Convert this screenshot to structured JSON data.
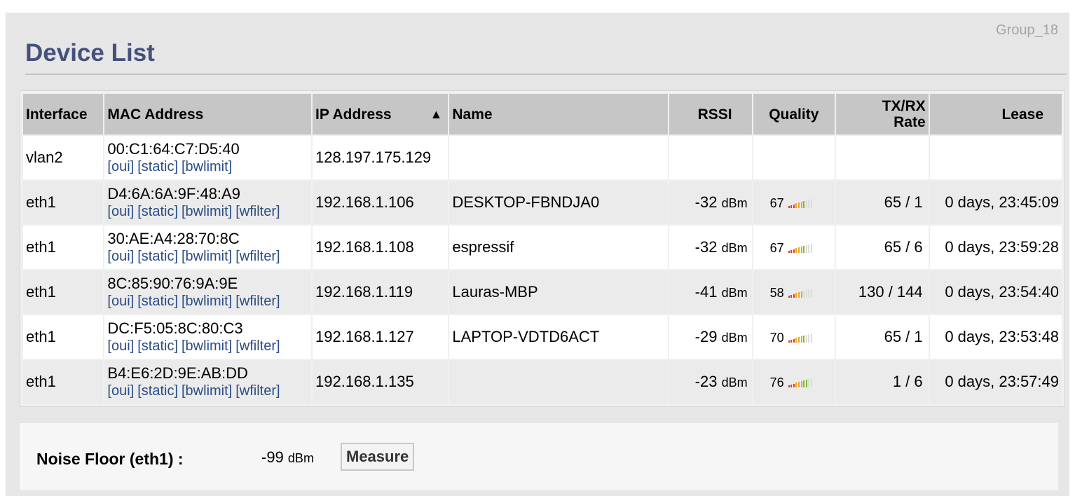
{
  "header": {
    "group": "Group_18",
    "title": "Device List"
  },
  "colors": {
    "title": "#45507c",
    "link": "#2a4d86",
    "bar_low": "#e03a1e",
    "bar_mid": "#e8a81e",
    "bar_high": "#7cbf2a"
  },
  "table": {
    "columns": {
      "interface": "Interface",
      "mac": "MAC Address",
      "ip": "IP Address",
      "sort_arrow": "▲",
      "name": "Name",
      "rssi": "RSSI",
      "quality": "Quality",
      "txrx_line1": "TX/RX",
      "txrx_line2": "Rate",
      "lease": "Lease"
    },
    "rows": [
      {
        "interface": "vlan2",
        "mac": "00:C1:64:C7:D5:40",
        "links": [
          "[oui]",
          "[static]",
          "[bwlimit]"
        ],
        "ip": "128.197.175.129",
        "name": "",
        "rssi": "",
        "rssi_unit": "",
        "quality": "",
        "quality_level": 0,
        "txrx": "",
        "lease": ""
      },
      {
        "interface": "eth1",
        "mac": "D4:6A:6A:9F:48:A9",
        "links": [
          "[oui]",
          "[static]",
          "[bwlimit]",
          "[wfilter]"
        ],
        "ip": "192.168.1.106",
        "name": "DESKTOP-FBNDJA0",
        "rssi": "-32",
        "rssi_unit": "dBm",
        "quality": "67",
        "quality_level": 0.67,
        "txrx": "65 / 1",
        "lease": "0 days, 23:45:09"
      },
      {
        "interface": "eth1",
        "mac": "30:AE:A4:28:70:8C",
        "links": [
          "[oui]",
          "[static]",
          "[bwlimit]",
          "[wfilter]"
        ],
        "ip": "192.168.1.108",
        "name": "espressif",
        "rssi": "-32",
        "rssi_unit": "dBm",
        "quality": "67",
        "quality_level": 0.67,
        "txrx": "65 / 6",
        "lease": "0 days, 23:59:28"
      },
      {
        "interface": "eth1",
        "mac": "8C:85:90:76:9A:9E",
        "links": [
          "[oui]",
          "[static]",
          "[bwlimit]",
          "[wfilter]"
        ],
        "ip": "192.168.1.119",
        "name": "Lauras-MBP",
        "rssi": "-41",
        "rssi_unit": "dBm",
        "quality": "58",
        "quality_level": 0.58,
        "txrx": "130 / 144",
        "lease": "0 days, 23:54:40"
      },
      {
        "interface": "eth1",
        "mac": "DC:F5:05:8C:80:C3",
        "links": [
          "[oui]",
          "[static]",
          "[bwlimit]",
          "[wfilter]"
        ],
        "ip": "192.168.1.127",
        "name": "LAPTOP-VDTD6ACT",
        "rssi": "-29",
        "rssi_unit": "dBm",
        "quality": "70",
        "quality_level": 0.7,
        "txrx": "65 / 1",
        "lease": "0 days, 23:53:48"
      },
      {
        "interface": "eth1",
        "mac": "B4:E6:2D:9E:AB:DD",
        "links": [
          "[oui]",
          "[static]",
          "[bwlimit]",
          "[wfilter]"
        ],
        "ip": "192.168.1.135",
        "name": "",
        "rssi": "-23",
        "rssi_unit": "dBm",
        "quality": "76",
        "quality_level": 0.76,
        "txrx": "1 / 6",
        "lease": "0 days, 23:57:49"
      }
    ]
  },
  "noise": {
    "label": "Noise Floor (eth1) :",
    "value": "-99",
    "unit": "dBm",
    "measure_label": "Measure"
  }
}
